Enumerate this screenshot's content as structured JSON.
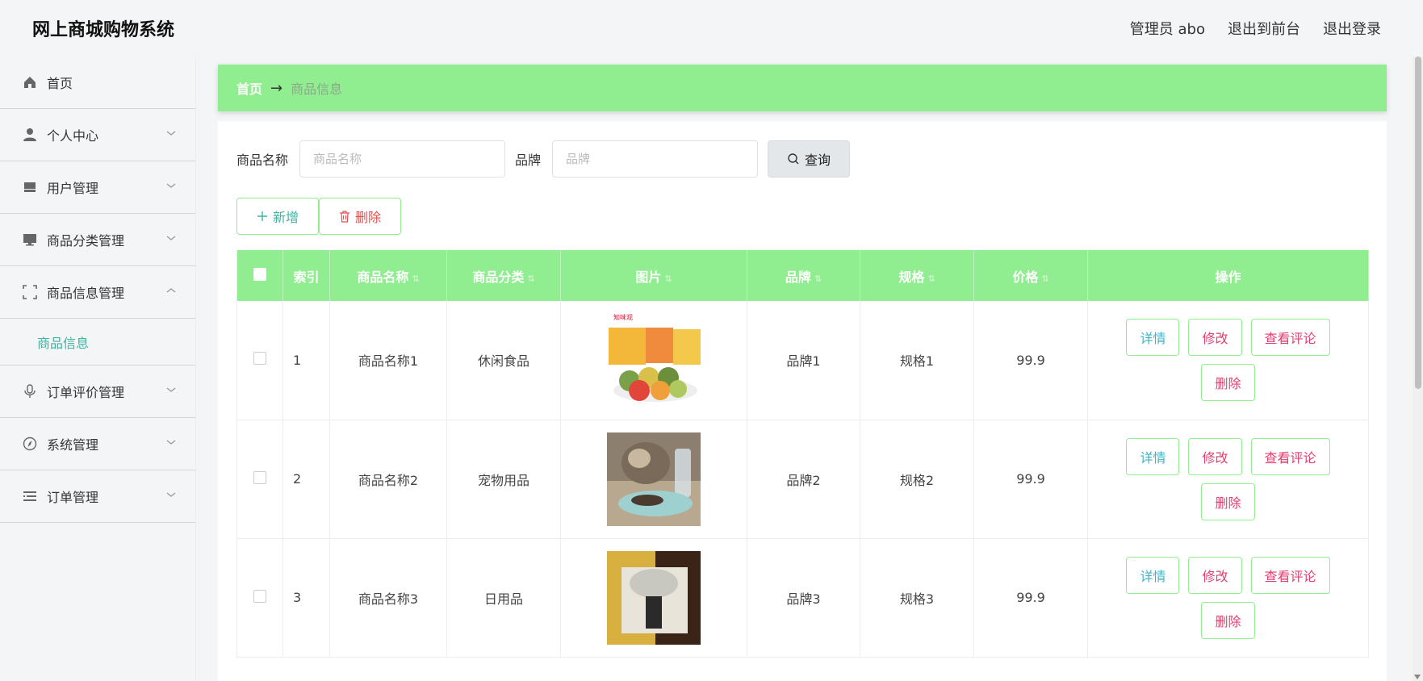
{
  "app": {
    "title": "网上商城购物系统"
  },
  "topnav": {
    "user": "管理员 abo",
    "front": "退出到前台",
    "logout": "退出登录"
  },
  "sidebar": {
    "items": [
      {
        "label": "首页",
        "icon": "home-icon"
      },
      {
        "label": "个人中心",
        "icon": "user-icon"
      },
      {
        "label": "用户管理",
        "icon": "inbox-icon"
      },
      {
        "label": "商品分类管理",
        "icon": "monitor-icon"
      },
      {
        "label": "商品信息管理",
        "icon": "frame-icon"
      },
      {
        "label": "订单评价管理",
        "icon": "mic-icon"
      },
      {
        "label": "系统管理",
        "icon": "compass-icon"
      },
      {
        "label": "订单管理",
        "icon": "list-icon"
      }
    ],
    "active_sub": "商品信息"
  },
  "breadcrumb": {
    "home": "首页",
    "arrow": "→",
    "current": "商品信息"
  },
  "search": {
    "name_label": "商品名称",
    "name_placeholder": "商品名称",
    "brand_label": "品牌",
    "brand_placeholder": "品牌",
    "query": "查询"
  },
  "actions": {
    "add": "新增",
    "delete": "删除"
  },
  "table": {
    "headers": [
      "索引",
      "商品名称",
      "商品分类",
      "图片",
      "品牌",
      "规格",
      "价格",
      "操作"
    ],
    "rows": [
      {
        "index": "1",
        "name": "商品名称1",
        "category": "休闲食品",
        "brand": "品牌1",
        "spec": "规格1",
        "price": "99.9",
        "image": "mooncake-photo"
      },
      {
        "index": "2",
        "name": "商品名称2",
        "category": "宠物用品",
        "brand": "品牌2",
        "spec": "规格2",
        "price": "99.9",
        "image": "cat-feeder-photo"
      },
      {
        "index": "3",
        "name": "商品名称3",
        "category": "日用品",
        "brand": "品牌3",
        "spec": "规格3",
        "price": "99.9",
        "image": "soap-dish-photo"
      }
    ],
    "ops": {
      "detail": "详情",
      "edit": "修改",
      "review": "查看评论",
      "delete": "删除"
    }
  },
  "colors": {
    "accent_green": "#90ee90",
    "teal": "#3cb4a0",
    "pink": "#e04070",
    "red": "#e05050"
  }
}
